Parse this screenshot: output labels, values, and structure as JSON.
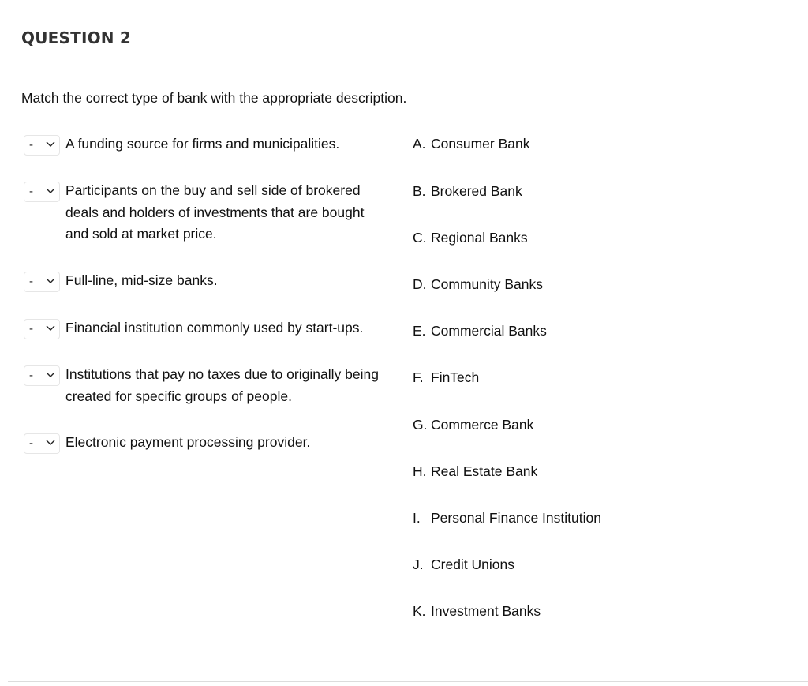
{
  "question": {
    "title": "QUESTION 2",
    "instruction": "Match the correct type of bank with the appropriate description."
  },
  "prompts": [
    {
      "selected": "-",
      "text": "A funding source for firms and municipalities."
    },
    {
      "selected": "-",
      "text": "Participants on the buy and sell side of brokered deals and holders of investments that are bought and sold at market price."
    },
    {
      "selected": "-",
      "text": "Full-line, mid-size banks."
    },
    {
      "selected": "-",
      "text": "Financial institution commonly used by start-ups."
    },
    {
      "selected": "-",
      "text": "Institutions that pay no taxes due to originally being created for specific groups of people."
    },
    {
      "selected": "-",
      "text": "Electronic payment processing provider."
    }
  ],
  "answers": [
    {
      "letter": "A.",
      "text": "Consumer Bank"
    },
    {
      "letter": "B.",
      "text": "Brokered Bank"
    },
    {
      "letter": "C.",
      "text": "Regional Banks"
    },
    {
      "letter": "D.",
      "text": "Community Banks"
    },
    {
      "letter": "E.",
      "text": "Commercial Banks"
    },
    {
      "letter": "F.",
      "text": "FinTech"
    },
    {
      "letter": "G.",
      "text": "Commerce Bank"
    },
    {
      "letter": "H.",
      "text": "Real Estate Bank"
    },
    {
      "letter": "I.",
      "text": "Personal Finance Institution"
    },
    {
      "letter": "J.",
      "text": "Credit Unions"
    },
    {
      "letter": "K.",
      "text": "Investment Banks"
    }
  ]
}
